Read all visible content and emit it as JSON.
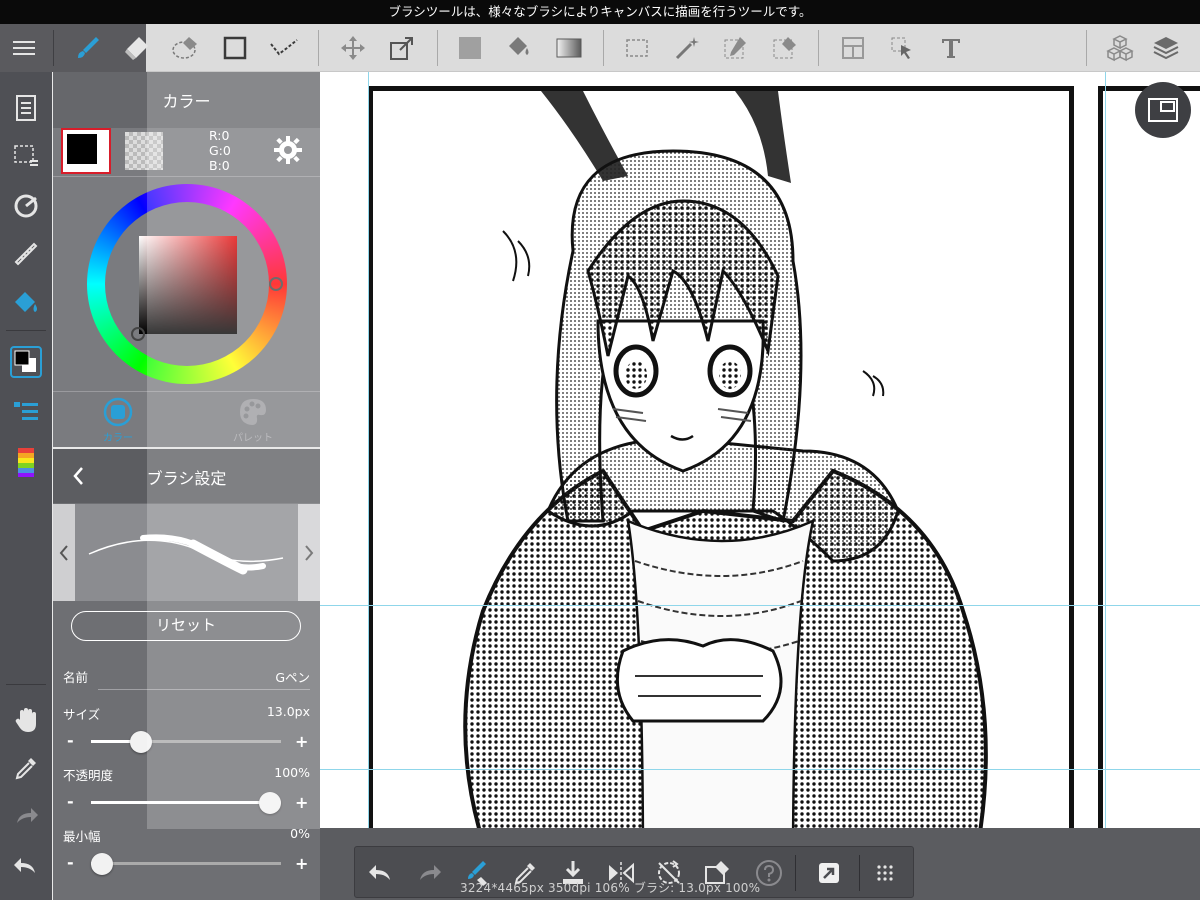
{
  "tooltip": "ブラシツールは、様々なブラシによりキャンバスに描画を行うツールです。",
  "color_panel": {
    "title": "カラー",
    "rgb": {
      "r": "R:0",
      "g": "G:0",
      "b": "B:0"
    },
    "tabs": [
      {
        "label": "カラー"
      },
      {
        "label": "パレット"
      }
    ]
  },
  "brush_panel": {
    "title": "ブラシ設定",
    "reset_label": "リセット",
    "name_label": "名前",
    "name_value": "Gペン",
    "size_label": "サイズ",
    "size_value": "13.0px",
    "size_fraction": 0.23,
    "opacity_label": "不透明度",
    "opacity_value": "100%",
    "opacity_fraction": 1.0,
    "min_width_label": "最小幅",
    "min_width_value": "0%",
    "min_width_fraction": 0.0,
    "minus": "-",
    "plus": "+"
  },
  "status": "3224*4465px 350dpi 106% ブラシ: 13.0px 100%",
  "colors": {
    "accent": "#2a9fd6",
    "primary_color": "#000000",
    "selection_border": "#d81d2a"
  }
}
